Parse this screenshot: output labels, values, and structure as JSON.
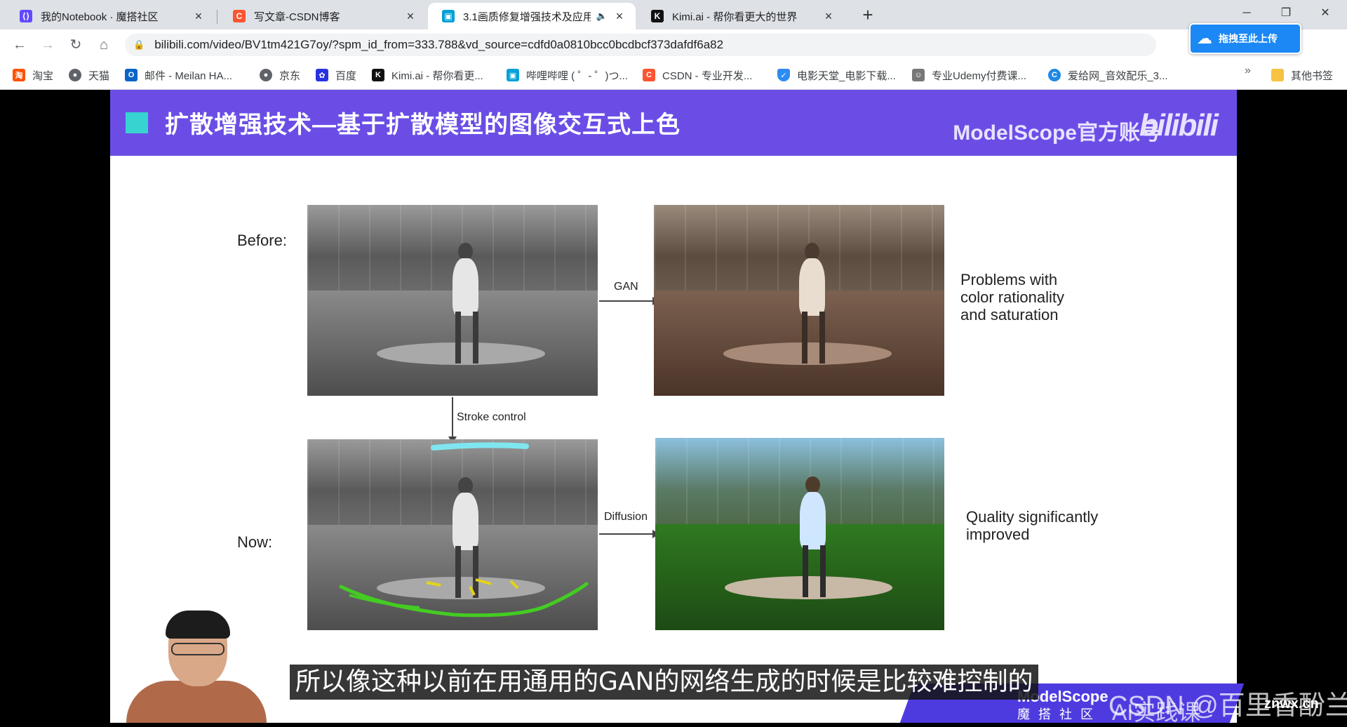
{
  "browser": {
    "tabs": [
      {
        "label": "我的Notebook · 魔搭社区",
        "icon": "modelscope-icon",
        "color": "#624aff"
      },
      {
        "label": "写文章-CSDN博客",
        "icon": "csdn-icon",
        "color": "#fc5531"
      },
      {
        "label": "3.1画质修复增强技术及应用",
        "icon": "bilibili-icon",
        "color": "#00a1d6",
        "active": true
      },
      {
        "label": "Kimi.ai - 帮你看更大的世界",
        "icon": "kimi-icon",
        "color": "#111111"
      }
    ],
    "url": "bilibili.com/video/BV1tm421G7oy/?spm_id_from=333.788&vd_source=cdfd0a0810bcc0bcdbcf373dafdf6a82",
    "upload_button": "拖拽至此上传",
    "bookmarks": [
      {
        "label": "淘宝",
        "icon": "taobao-icon",
        "color": "#ff5000"
      },
      {
        "label": "天猫",
        "icon": "globe-icon",
        "color": "#5f6368"
      },
      {
        "label": "邮件 - Meilan HA...",
        "icon": "outlook-icon",
        "color": "#0a64c8"
      },
      {
        "label": "京东",
        "icon": "globe-icon",
        "color": "#5f6368"
      },
      {
        "label": "百度",
        "icon": "baidu-icon",
        "color": "#2932e1"
      },
      {
        "label": "Kimi.ai - 帮你看更...",
        "icon": "kimi-icon",
        "color": "#111111"
      },
      {
        "label": "哔哩哔哩 ( ゜- ゜)つ...",
        "icon": "bilibili-icon",
        "color": "#00a1d6"
      },
      {
        "label": "CSDN - 专业开发...",
        "icon": "csdn-icon",
        "color": "#fc5531"
      },
      {
        "label": "电影天堂_电影下载...",
        "icon": "shield-icon",
        "color": "#2d8cf0"
      },
      {
        "label": "专业Udemy付费课...",
        "icon": "people-icon",
        "color": "#777777"
      },
      {
        "label": "爱给网_音效配乐_3...",
        "icon": "aigei-icon",
        "color": "#1e88e5"
      }
    ],
    "other_bookmarks": "其他书签"
  },
  "slide": {
    "title": "扩散增强技术—基于扩散模型的图像交互式上色",
    "brand": "ModelScope官方账号",
    "bilibili_logo": "bilibili",
    "before_label": "Before:",
    "now_label": "Now:",
    "gan_label": "GAN",
    "stroke_label": "Stroke control",
    "diffusion_label": "Diffusion",
    "gan_note": [
      "Problems with",
      "color rationality",
      "and saturation"
    ],
    "diffusion_note": [
      "Quality significantly",
      "improved"
    ]
  },
  "subtitle": "所以像这种以前在用通用的GAN的网络生成的时候是比较难控制的",
  "watermarks": {
    "modelscope": "ModelScope",
    "modelscope_cn": "魔搭社区",
    "csdn": "CSDN @百里香酚兰",
    "ai_course": "AI实践课",
    "znwx": "znwx.cn"
  },
  "colors": {
    "slide_header": "#6b4de6",
    "accent_square": "#37d3d1"
  }
}
